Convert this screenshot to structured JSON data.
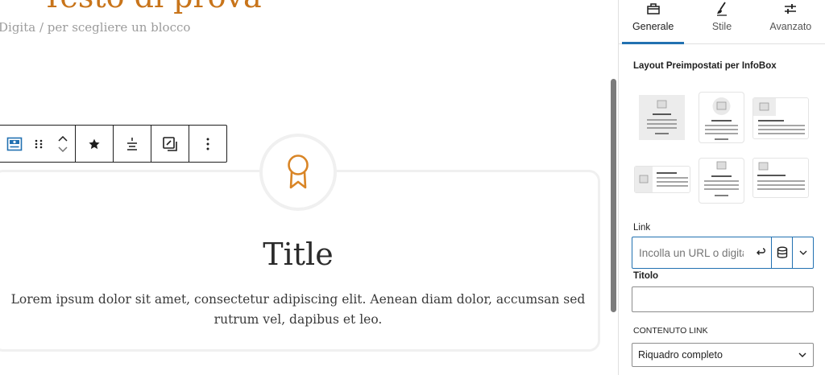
{
  "editor": {
    "heading_text": "Testo di prova",
    "block_placeholder": "Digita / per scegliere un blocco"
  },
  "toolbar": {
    "icons": [
      "infobox-block-icon",
      "drag-handle-icon",
      "move-up-icon",
      "move-down-icon",
      "star-icon",
      "align-icon",
      "crop-icon",
      "more-options-icon"
    ]
  },
  "infobox": {
    "icon": "medal-award-icon",
    "title": "Title",
    "description": "Lorem ipsum dolor sit amet, consectetur adipiscing elit. Aenean diam dolor, accumsan sed rutrum vel, dapibus et leo."
  },
  "sidebar": {
    "tabs": [
      {
        "label": "Generale",
        "icon": "toolbox-icon",
        "active": true
      },
      {
        "label": "Stile",
        "icon": "brush-icon",
        "active": false
      },
      {
        "label": "Avanzato",
        "icon": "sliders-icon",
        "active": false
      }
    ],
    "layout_section_title": "Layout Preimpostati per InfoBox",
    "link_label": "Link",
    "link_placeholder": "Incolla un URL o digita per cercare",
    "title_label": "Titolo",
    "title_value": "",
    "content_link_label": "CONTENUTO LINK",
    "content_link_value": "Riquadro completo"
  },
  "colors": {
    "accent": "#2271b1",
    "brand_orange": "#d98526",
    "heading_orange": "#c8741a"
  }
}
